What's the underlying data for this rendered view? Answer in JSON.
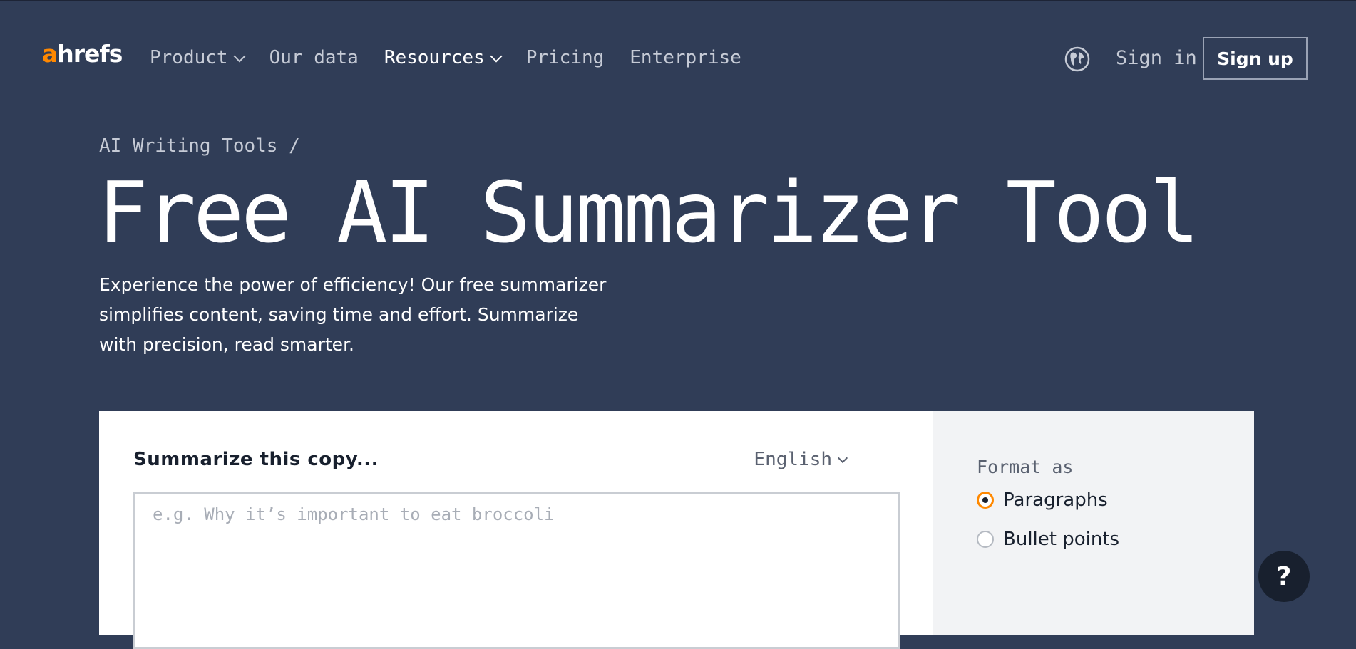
{
  "header": {
    "logo": {
      "accent": "a",
      "rest": "hrefs",
      "accent_color": "#ff8800"
    },
    "nav": [
      {
        "label": "Product",
        "has_dropdown": true
      },
      {
        "label": "Our data",
        "has_dropdown": false
      },
      {
        "label": "Resources",
        "has_dropdown": true
      },
      {
        "label": "Pricing",
        "has_dropdown": false
      },
      {
        "label": "Enterprise",
        "has_dropdown": false
      }
    ],
    "globe_icon": "globe-icon",
    "signin_label": "Sign in",
    "signup_label": "Sign up"
  },
  "hero": {
    "breadcrumb": {
      "label": "AI Writing Tools",
      "separator": "/"
    },
    "title": "Free AI Summarizer Tool",
    "subtitle": "Experience the power of efficiency! Our free summarizer simplifies content, saving time and effort. Summarize with precision, read smarter."
  },
  "tool": {
    "input_label": "Summarize this copy...",
    "language": "English",
    "placeholder": "e.g. Why it’s important to eat broccoli",
    "value": "",
    "format": {
      "label": "Format as",
      "options": [
        {
          "label": "Paragraphs",
          "checked": true
        },
        {
          "label": "Bullet points",
          "checked": false
        }
      ]
    }
  },
  "help_button": {
    "label": "?"
  },
  "colors": {
    "background": "#303d57",
    "accent": "#ff8800",
    "card": "#ffffff",
    "panel": "#f2f3f5",
    "dark": "#18202e"
  }
}
